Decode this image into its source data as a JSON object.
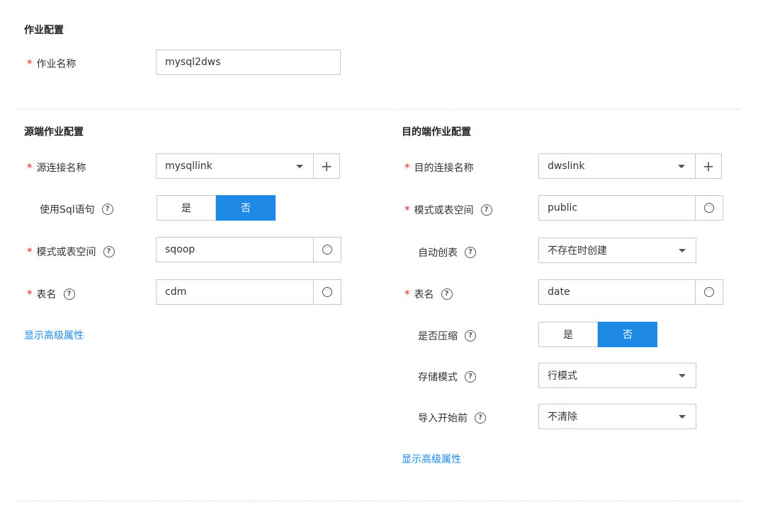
{
  "job": {
    "section_title": "作业配置",
    "name_label": "作业名称",
    "name_value": "mysql2dws"
  },
  "source": {
    "section_title": "源端作业配置",
    "connection_label": "源连接名称",
    "connection_value": "mysqllink",
    "use_sql_label": "使用Sql语句",
    "use_sql_yes": "是",
    "use_sql_no": "否",
    "schema_label": "模式或表空间",
    "schema_value": "sqoop",
    "table_label": "表名",
    "table_value": "cdm",
    "advanced_link": "显示高级属性"
  },
  "target": {
    "section_title": "目的端作业配置",
    "connection_label": "目的连接名称",
    "connection_value": "dwslink",
    "schema_label": "模式或表空间",
    "schema_value": "public",
    "auto_create_label": "自动创表",
    "auto_create_value": "不存在时创建",
    "table_label": "表名",
    "table_value": "date",
    "compress_label": "是否压缩",
    "compress_yes": "是",
    "compress_no": "否",
    "storage_label": "存储模式",
    "storage_value": "行模式",
    "before_import_label": "导入开始前",
    "before_import_value": "不清除",
    "advanced_link": "显示高级属性"
  },
  "icons": {
    "required": "*",
    "help": "?",
    "add": "+",
    "more": "···"
  },
  "colors": {
    "accent": "#1e88e5",
    "required": "#f5222d"
  }
}
